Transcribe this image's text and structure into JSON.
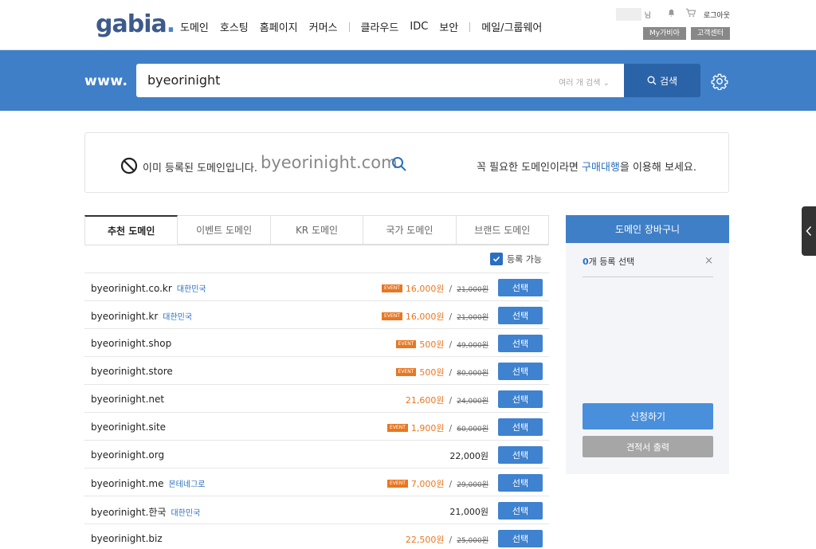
{
  "header": {
    "logo": "gabia",
    "logo_dot": ".",
    "nav": [
      "도메인",
      "호스팅",
      "홈페이지",
      "커머스",
      "클라우드",
      "IDC",
      "보안",
      "메일/그룹웨어"
    ],
    "user_suffix": "님",
    "logout": "로그아웃",
    "my_gabia": "My가비아",
    "support": "고객센터"
  },
  "search": {
    "prefix": "www.",
    "value": "byeorinight",
    "multi_search": "여러 개 검색",
    "button": "검색"
  },
  "notice": {
    "message": "이미 등록된 도메인입니다.",
    "domain": "byeorinight.com",
    "hint_before": "꼭 필요한 도메인이라면 ",
    "hint_link": "구매대행",
    "hint_after": "을 이용해 보세요."
  },
  "tabs": [
    "추천 도메인",
    "이벤트 도메인",
    "KR 도메인",
    "국가 도메인",
    "브랜드 도메인"
  ],
  "filter": {
    "available_label": "등록 가능"
  },
  "event_badge": "EVENT",
  "select_label": "선택",
  "domains": [
    {
      "name": "byeorinight.co.kr",
      "region": "대한민국",
      "event": true,
      "price": "16,000원",
      "original": "21,000원"
    },
    {
      "name": "byeorinight.kr",
      "region": "대한민국",
      "event": true,
      "price": "16,000원",
      "original": "21,000원"
    },
    {
      "name": "byeorinight.shop",
      "region": "",
      "event": true,
      "price": "500원",
      "original": "49,000원"
    },
    {
      "name": "byeorinight.store",
      "region": "",
      "event": true,
      "price": "500원",
      "original": "80,000원"
    },
    {
      "name": "byeorinight.net",
      "region": "",
      "event": false,
      "price": "21,600원",
      "original": "24,000원"
    },
    {
      "name": "byeorinight.site",
      "region": "",
      "event": true,
      "price": "1,900원",
      "original": "60,000원"
    },
    {
      "name": "byeorinight.org",
      "region": "",
      "event": false,
      "price": "22,000원",
      "original": ""
    },
    {
      "name": "byeorinight.me",
      "region": "몬테네그로",
      "event": true,
      "price": "7,000원",
      "original": "29,000원"
    },
    {
      "name": "byeorinight.한국",
      "region": "대한민국",
      "event": false,
      "price": "21,000원",
      "original": ""
    },
    {
      "name": "byeorinight.biz",
      "region": "",
      "event": false,
      "price": "22,500원",
      "original": "25,000원"
    }
  ],
  "cart": {
    "title": "도메인 장바구니",
    "count": "0",
    "count_suffix": "개 등록 선택",
    "apply": "신청하기",
    "quote": "견적서 출력"
  },
  "colors": {
    "brand_blue": "#3f7fc7",
    "event_orange": "#e87722",
    "link_blue": "#2a6fc0"
  }
}
